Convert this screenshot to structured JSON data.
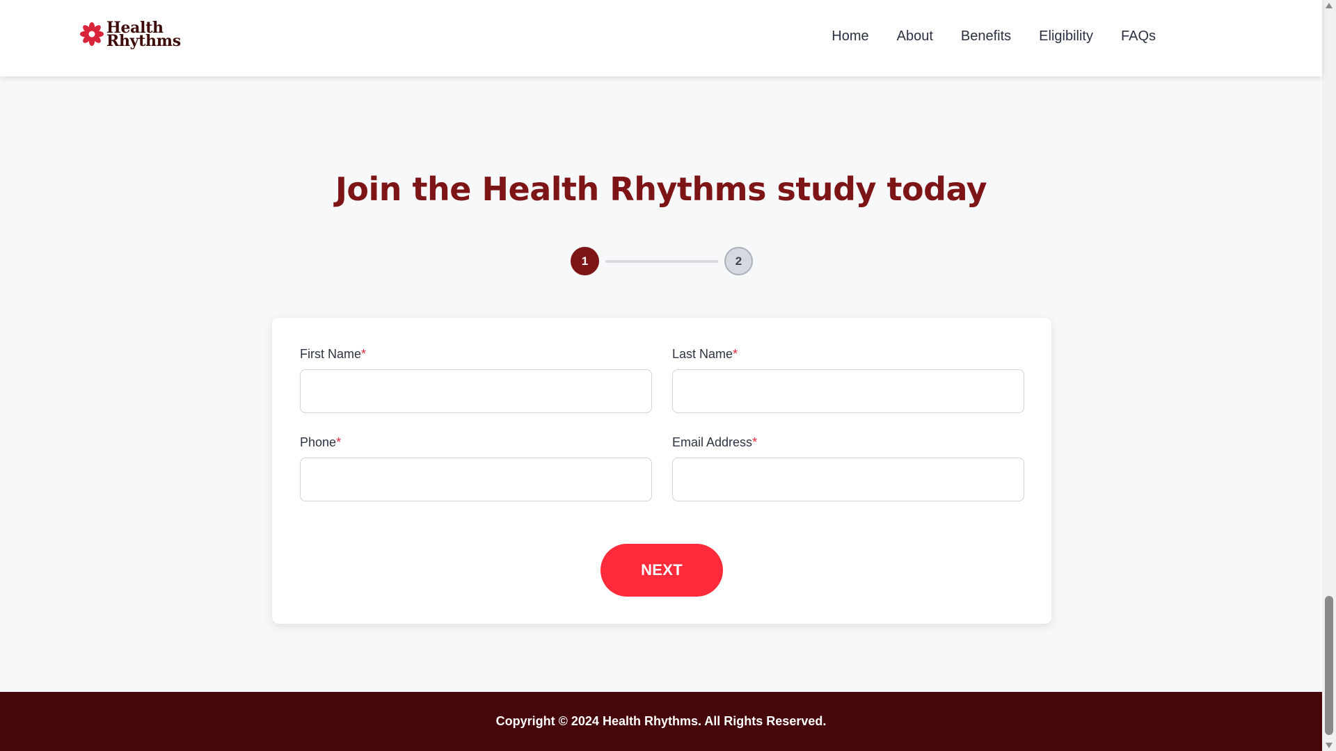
{
  "header": {
    "logo": {
      "line1": "Health",
      "line2": "Rhythms",
      "icon": "flower-logo-icon"
    },
    "nav": [
      {
        "label": "Home"
      },
      {
        "label": "About"
      },
      {
        "label": "Benefits"
      },
      {
        "label": "Eligibility"
      },
      {
        "label": "FAQs"
      }
    ]
  },
  "main": {
    "title": "Join the Health Rhythms study today",
    "stepper": {
      "current_step": 1,
      "steps": [
        "1",
        "2"
      ]
    },
    "form": {
      "first_name": {
        "label": "First Name",
        "required": "*",
        "value": ""
      },
      "last_name": {
        "label": "Last Name",
        "required": "*",
        "value": ""
      },
      "phone": {
        "label": "Phone",
        "required": "*",
        "value": ""
      },
      "email": {
        "label": "Email Address",
        "required": "*",
        "value": ""
      },
      "next_label": "NEXT"
    }
  },
  "footer": {
    "copyright": "Copyright © 2024 Health Rhythms. All Rights Reserved."
  },
  "colors": {
    "brand_dark": "#7d1416",
    "accent": "#ff2a3a",
    "footer_bg": "#46070a",
    "required": "#e0283a"
  }
}
